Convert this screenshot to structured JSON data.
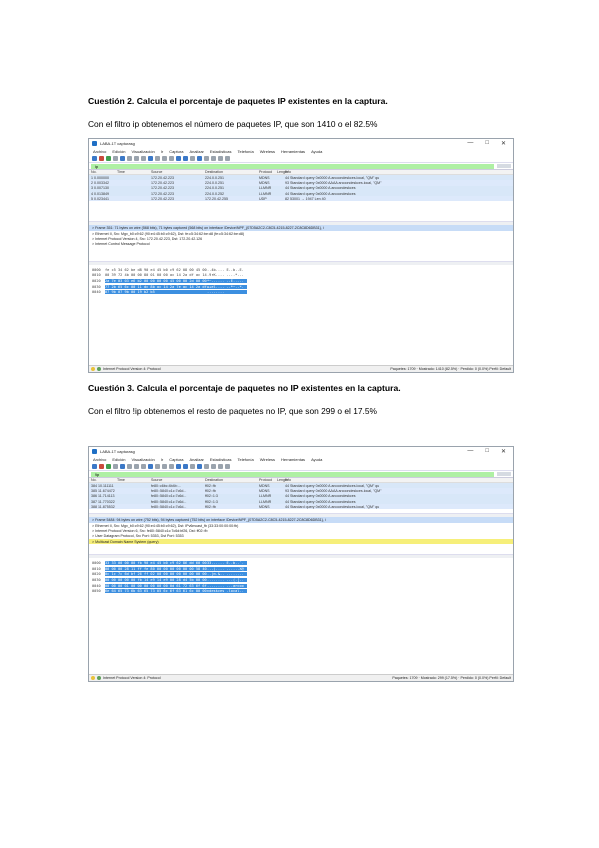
{
  "q2": {
    "heading": "Cuestión 2. Calcula el porcentaje de paquetes IP existentes en la captura.",
    "text": "Con el filtro ip obtenemos el número de paquetes IP, que son 1410 o el 82.5%"
  },
  "q3": {
    "heading": "Cuestión 3. Calcula el porcentaje de paquetes no IP existentes en la captura.",
    "text": "Con el filtro !ip obtenemos el resto de paquetes no IP, que son 299 o el 17.5%"
  },
  "capture1": {
    "title": "LABA-1T capturasg",
    "window_controls": [
      "—",
      "□",
      "✕"
    ],
    "menu": [
      "Archivo",
      "Edición",
      "Visualización",
      "Ir",
      "Captura",
      "Analizar",
      "Estadísticas",
      "Telefonía",
      "Wireless",
      "Herramientas",
      "Ayuda"
    ],
    "filter": "ip",
    "columns": [
      "No.",
      "Time",
      "Source",
      "Destination",
      "Protocol",
      "Length",
      "Info"
    ],
    "rows": [
      {
        "no": "1 0.000000",
        "time": "",
        "src": "172.20.42.223",
        "dst": "224.0.0.251",
        "proto": "MDNS",
        "len": "",
        "info": "44 Standard query 0x0000 A arcoondeskces.local, \"QM\" qu"
      },
      {
        "no": "2 0.003342",
        "time": "",
        "src": "172.20.42.223",
        "dst": "224.0.0.251",
        "proto": "MDNS",
        "len": "",
        "info": "93 Standard query 0x0000 AAAA arcoondeskces.local, \"QM\""
      },
      {
        "no": "3 0.007130",
        "time": "",
        "src": "172.20.42.223",
        "dst": "224.0.0.251",
        "proto": "LLMNR",
        "len": "",
        "info": "44 Standard query 0x0000 A arcoondeskces"
      },
      {
        "no": "4 0.013849",
        "time": "",
        "src": "172.20.42.223",
        "dst": "224.0.0.252",
        "proto": "LLMNR",
        "len": "",
        "info": "44 Standard query 0x0000 A arcoondeskces"
      },
      {
        "no": "5 0.023441",
        "time": "",
        "src": "172.20.42.223",
        "dst": "172.20.42.255",
        "proto": "UDP",
        "len": "",
        "info": "82 53001 → 1947 Len 40"
      }
    ],
    "details": [
      "> Frame 351: 71 bytes on wire (568 bits), 71 bytes captured (568 bits) on interface \\Device\\NPF_{07D5A2C2-C8C5-4215-8227-2C8C8D6DB31}, i",
      "> Ethernet II, Src: Mgx_b0:c9:62 (90:e4:45:b0:c9:62), Dst: fe:c5:34:62:be:d8 (fe:c5:34:62:be:d8)",
      "> Internet Protocol Version 4, Src: 172.20.42.223, Dst: 172.20.42.126",
      "> Internet Control Message Protocol"
    ],
    "hex": [
      {
        "off": "0000",
        "bytes": "fe c5 34 62 be d8 90 e4 45 b0 c9 62 08 00 45 00",
        "ascii": "..4b.... E..b..E."
      },
      {
        "off": "0010",
        "bytes": "00 39 72 4b 00 00 80 01 00 00 ac 14 2a df ac 14",
        "ascii": ".9rK.... ....*..."
      },
      {
        "off": "0020",
        "bytes": "2a 7e 03 03 e6 b2 00 00 00 00 45 00 00 2d 00 00",
        "ascii": "*~...... ..E..-.."
      },
      {
        "off": "0030",
        "bytes": "77 2b 65 6c 00 11 dc 8b ac 14 2a 7e ac 14 2a df",
        "ascii": "w+el.... ..*~..*."
      },
      {
        "off": "0040",
        "bytes": "07 9b 07 9b 00 19 b2 b5",
        "ascii": "........"
      }
    ],
    "status_left": "Internet Protocol Version 4: Protocol",
    "status_right": "Paquetes: 1709 · Mostrado: 1410 (82.5%) · Perdido: 0 (0.0%)    Perfil: Default"
  },
  "capture2": {
    "title": "LABA-1T capturasg",
    "window_controls": [
      "—",
      "□",
      "✕"
    ],
    "menu": [
      "Archivo",
      "Edición",
      "Visualización",
      "Ir",
      "Captura",
      "Analizar",
      "Estadísticas",
      "Telefonía",
      "Wireless",
      "Herramientas",
      "Ayuda"
    ],
    "filter": "!ip",
    "columns": [
      "No.",
      "Time",
      "Source",
      "Destination",
      "Protocol",
      "Length",
      "Info"
    ],
    "rows": [
      {
        "no": "384 10.111111",
        "time": "",
        "src": "fe80::c6bc:4b4b:...",
        "dst": "ff02::fb",
        "proto": "MDNS",
        "len": "",
        "info": "44 Standard query 0x0000 A arcoondeskces.local, \"QM\" qu"
      },
      {
        "no": "385 11.674472",
        "time": "",
        "src": "fe80::5840:c1c:7c6d...",
        "dst": "ff02::fb",
        "proto": "MDNS",
        "len": "",
        "info": "93 Standard query 0x0000 AAAA arcoondeskces.local, \"QM\""
      },
      {
        "no": "386 11.714113",
        "time": "",
        "src": "fe80::5840:c1c:7c6d...",
        "dst": "ff02::1:3",
        "proto": "LLMNR",
        "len": "",
        "info": "44 Standard query 0x0000 A arcoondeskces"
      },
      {
        "no": "387 11.770322",
        "time": "",
        "src": "fe80::5840:c1c:7c6d...",
        "dst": "ff02::1:3",
        "proto": "LLMNR",
        "len": "",
        "info": "44 Standard query 0x0000 A arcoondeskces"
      },
      {
        "no": "388 11.875532",
        "time": "",
        "src": "fe80::5840:c1c:7c6d...",
        "dst": "ff02::fb",
        "proto": "MDNS",
        "len": "",
        "info": "44 Standard query 0x0000 A arcoondeskces.local, \"QM\" qu"
      }
    ],
    "details": [
      "> Frame 5484: 94 bytes on wire (752 bits), 94 bytes captured (752 bits) on interface \\Device\\NPF_{07D5A2C2-C8C5-4215-8227-2C8C8D6DB31}, i",
      "> Ethernet II, Src: Mgx_b0:c9:62 (90:e4:45:b0:c9:62), Dst: IPv6mcast_fb (33:33:00:00:00:fb)",
      "> Internet Protocol Version 6, Src: fe80::5840:c1c:7c6d:bf26, Dst: ff02::fb",
      "> User Datagram Protocol, Src Port: 5353, Dst Port: 5353",
      "> Multicast Domain Name System (query)"
    ],
    "hex": [
      {
        "off": "0000",
        "bytes": "33 33 00 00 00 fb 90 e4 45 b0 c9 62 86 dd 60 00",
        "ascii": "33...... E..b..`."
      },
      {
        "off": "0010",
        "bytes": "00 00 00 28 11 ff fe 80 00 00 00 00 00 00 58 40",
        "ascii": "...(.... ......X@"
      },
      {
        "off": "0020",
        "bytes": "0c 1c 7c 6d bf 26 ff 02 00 00 00 00 00 00 00 00",
        "ascii": "..|m.&.. ........"
      },
      {
        "off": "0030",
        "bytes": "00 00 00 00 00 fb 14 e9 14 e9 00 28 d4 5b 00 00",
        "ascii": "........ ...(.[.."
      },
      {
        "off": "0040",
        "bytes": "00 00 00 01 00 00 00 00 00 00 0d 61 72 63 6f 6f",
        "ascii": "........ ...arcoo"
      },
      {
        "off": "0050",
        "bytes": "6e 64 65 73 6b 63 65 73 05 6c 6f 63 61 6c 00 00",
        "ascii": "ndeskces .local.."
      }
    ],
    "status_left": "Internet Protocol Version 4: Protocol",
    "status_right": "Paquetes: 1709 · Mostrado: 299 (17.5%) · Perdido: 0 (0.0%)    Perfil: Default"
  }
}
